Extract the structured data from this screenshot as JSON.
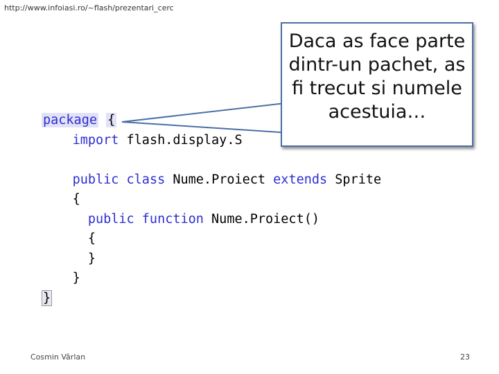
{
  "header": {
    "url": "http://www.infoiasi.ro/~flash/prezentari_cerc"
  },
  "code": {
    "line1": {
      "keyword": "package",
      "brace": "{"
    },
    "line2": {
      "keyword": "import",
      "text": "flash.display.S"
    },
    "line3": {
      "kw_public": "public",
      "kw_class": "class",
      "name": "Nume.Proiect",
      "kw_extends": "extends",
      "parent": "Sprite"
    },
    "line4": {
      "brace": "{"
    },
    "line5": {
      "kw_public": "public",
      "kw_function": "function",
      "name": "Nume.Proiect()"
    },
    "line6": {
      "brace": "{"
    },
    "line7": {
      "brace": "}"
    },
    "line8": {
      "brace": "}"
    },
    "line9": {
      "brace": "}"
    }
  },
  "callout": {
    "line1": "Daca as face parte",
    "line2": "dintr-un pachet, as",
    "line3": "fi trecut si numele",
    "line4": "acestuia…",
    "border_color": "#4a6fa5"
  },
  "footer": {
    "author": "Cosmin Vârlan",
    "page_number": "23"
  },
  "colors": {
    "keyword": "#2d2dd2",
    "package_highlight": "#e1e1f8"
  }
}
